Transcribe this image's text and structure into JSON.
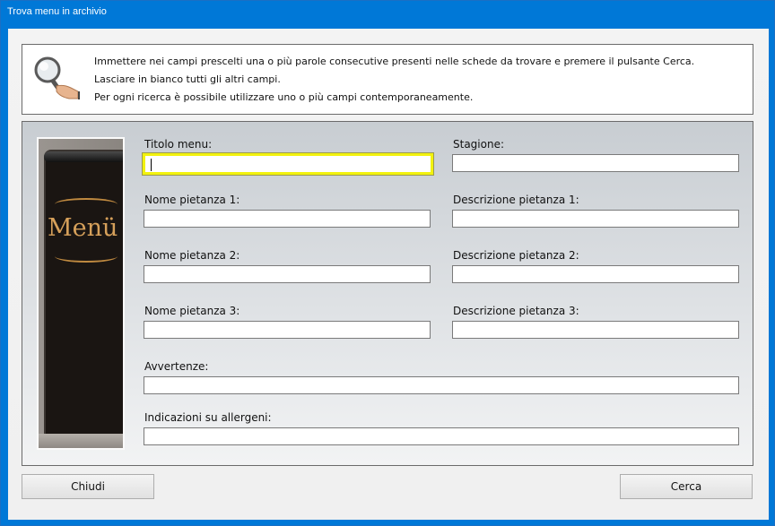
{
  "window": {
    "title": "Trova menu in archivio"
  },
  "info": {
    "icon": "magnifier-hand-icon",
    "lines": [
      "Immettere nei campi prescelti una o più parole consecutive presenti nelle schede da trovare e premere il pulsante Cerca.",
      "Lasciare in bianco tutti gli altri campi.",
      "Per ogni ricerca è possibile utilizzare uno o più campi contemporaneamente."
    ]
  },
  "side_image": {
    "text": "Menü"
  },
  "fields": {
    "titolo_menu": {
      "label": "Titolo menu:",
      "value": ""
    },
    "stagione": {
      "label": "Stagione:",
      "value": ""
    },
    "nome_pietanza_1": {
      "label": "Nome pietanza 1:",
      "value": ""
    },
    "descrizione_pietanza_1": {
      "label": "Descrizione pietanza 1:",
      "value": ""
    },
    "nome_pietanza_2": {
      "label": "Nome pietanza 2:",
      "value": ""
    },
    "descrizione_pietanza_2": {
      "label": "Descrizione pietanza 2:",
      "value": ""
    },
    "nome_pietanza_3": {
      "label": "Nome pietanza 3:",
      "value": ""
    },
    "descrizione_pietanza_3": {
      "label": "Descrizione pietanza 3:",
      "value": ""
    },
    "avvertenze": {
      "label": "Avvertenze:",
      "value": ""
    },
    "allergeni": {
      "label": "Indicazioni su allergeni:",
      "value": ""
    }
  },
  "buttons": {
    "close": "Chiudi",
    "search": "Cerca"
  },
  "colors": {
    "titlebar": "#0078d7",
    "focus_border": "#f2f20e"
  }
}
